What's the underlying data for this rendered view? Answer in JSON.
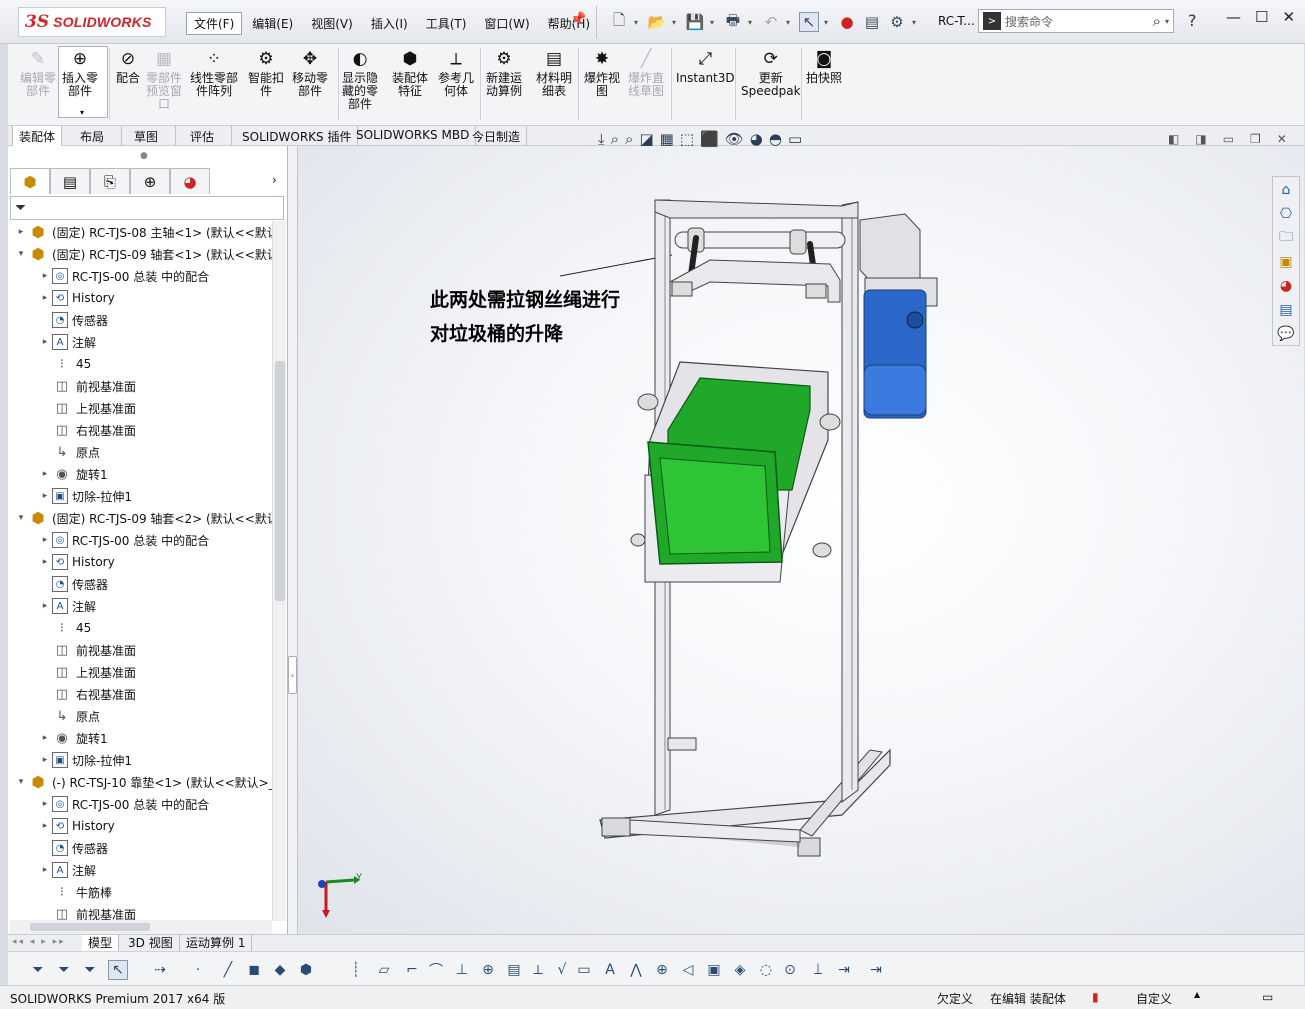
{
  "app": {
    "logo_prefix": "3S",
    "logo_text": "SOLIDWORKS",
    "doc_short": "RC-T...",
    "search_placeholder": "搜索命令",
    "help_label": "?"
  },
  "menus": [
    "文件(F)",
    "编辑(E)",
    "视图(V)",
    "插入(I)",
    "工具(T)",
    "窗口(W)",
    "帮助(H)"
  ],
  "commands": [
    {
      "label": "编辑零\n部件",
      "icon": "edit-component-icon",
      "glyph": "✎",
      "disabled": true
    },
    {
      "label": "插入零\n部件",
      "icon": "insert-component-icon",
      "glyph": "⊕",
      "disabled": false
    },
    {
      "label": "配合",
      "icon": "mate-icon",
      "glyph": "⊘",
      "disabled": false
    },
    {
      "label": "零部件\n预览窗\n口",
      "icon": "component-preview-icon",
      "glyph": "▦",
      "disabled": true
    },
    {
      "label": "线性零部\n件阵列",
      "icon": "linear-pattern-icon",
      "glyph": "⁘",
      "disabled": false
    },
    {
      "label": "智能扣\n件",
      "icon": "smart-fastener-icon",
      "glyph": "⚙",
      "disabled": false
    },
    {
      "label": "移动零\n部件",
      "icon": "move-component-icon",
      "glyph": "✥",
      "disabled": false
    },
    {
      "label": "显示隐\n藏的零\n部件",
      "icon": "show-hidden-icon",
      "glyph": "◐",
      "disabled": false
    },
    {
      "label": "装配体\n特征",
      "icon": "assembly-feature-icon",
      "glyph": "⬢",
      "disabled": false
    },
    {
      "label": "参考几\n何体",
      "icon": "reference-geometry-icon",
      "glyph": "⟂",
      "disabled": false
    },
    {
      "label": "新建运\n动算例",
      "icon": "motion-study-icon",
      "glyph": "⚙",
      "disabled": false
    },
    {
      "label": "材料明\n细表",
      "icon": "bom-icon",
      "glyph": "▤",
      "disabled": false
    },
    {
      "label": "爆炸视\n图",
      "icon": "exploded-view-icon",
      "glyph": "✸",
      "disabled": false
    },
    {
      "label": "爆炸直\n线草图",
      "icon": "explode-line-icon",
      "glyph": "╱",
      "disabled": true
    },
    {
      "label": "Instant3D",
      "icon": "instant3d-icon",
      "glyph": "⤢",
      "disabled": false
    },
    {
      "label": "更新\nSpeedpak",
      "icon": "speedpak-icon",
      "glyph": "⟳",
      "disabled": false
    },
    {
      "label": "拍快照",
      "icon": "snapshot-icon",
      "glyph": "◙",
      "disabled": false
    }
  ],
  "cmd_tabs": [
    "装配体",
    "布局",
    "草图",
    "评估",
    "SOLIDWORKS 插件",
    "SOLIDWORKS MBD",
    "今日制造"
  ],
  "tree": [
    {
      "indent": 0,
      "toggle": "▸",
      "icon": "part",
      "label": "(固定) RC-TJS-08 主轴<1> (默认<<默认"
    },
    {
      "indent": 0,
      "toggle": "▾",
      "icon": "part",
      "label": "(固定) RC-TJS-09 轴套<1> (默认<<默认"
    },
    {
      "indent": 1,
      "toggle": "▸",
      "icon": "mates",
      "label": "RC-TJS-00 总装 中的配合"
    },
    {
      "indent": 1,
      "toggle": "▸",
      "icon": "history",
      "label": "History"
    },
    {
      "indent": 1,
      "toggle": "",
      "icon": "sensor",
      "label": "传感器"
    },
    {
      "indent": 1,
      "toggle": "▸",
      "icon": "annotation",
      "label": "注解"
    },
    {
      "indent": 1,
      "toggle": "",
      "icon": "material",
      "label": "45"
    },
    {
      "indent": 1,
      "toggle": "",
      "icon": "plane",
      "label": "前视基准面"
    },
    {
      "indent": 1,
      "toggle": "",
      "icon": "plane",
      "label": "上视基准面"
    },
    {
      "indent": 1,
      "toggle": "",
      "icon": "plane",
      "label": "右视基准面"
    },
    {
      "indent": 1,
      "toggle": "",
      "icon": "origin",
      "label": "原点"
    },
    {
      "indent": 1,
      "toggle": "▸",
      "icon": "revolve",
      "label": "旋转1"
    },
    {
      "indent": 1,
      "toggle": "▸",
      "icon": "cut",
      "label": "切除-拉伸1"
    },
    {
      "indent": 0,
      "toggle": "▾",
      "icon": "part",
      "label": "(固定) RC-TJS-09 轴套<2> (默认<<默认"
    },
    {
      "indent": 1,
      "toggle": "▸",
      "icon": "mates",
      "label": "RC-TJS-00 总装 中的配合"
    },
    {
      "indent": 1,
      "toggle": "▸",
      "icon": "history",
      "label": "History"
    },
    {
      "indent": 1,
      "toggle": "",
      "icon": "sensor",
      "label": "传感器"
    },
    {
      "indent": 1,
      "toggle": "▸",
      "icon": "annotation",
      "label": "注解"
    },
    {
      "indent": 1,
      "toggle": "",
      "icon": "material",
      "label": "45"
    },
    {
      "indent": 1,
      "toggle": "",
      "icon": "plane",
      "label": "前视基准面"
    },
    {
      "indent": 1,
      "toggle": "",
      "icon": "plane",
      "label": "上视基准面"
    },
    {
      "indent": 1,
      "toggle": "",
      "icon": "plane",
      "label": "右视基准面"
    },
    {
      "indent": 1,
      "toggle": "",
      "icon": "origin",
      "label": "原点"
    },
    {
      "indent": 1,
      "toggle": "▸",
      "icon": "revolve",
      "label": "旋转1"
    },
    {
      "indent": 1,
      "toggle": "▸",
      "icon": "cut",
      "label": "切除-拉伸1"
    },
    {
      "indent": 0,
      "toggle": "▾",
      "icon": "part",
      "label": "(-) RC-TSJ-10 靠垫<1> (默认<<默认>_"
    },
    {
      "indent": 1,
      "toggle": "▸",
      "icon": "mates",
      "label": "RC-TJS-00 总装 中的配合"
    },
    {
      "indent": 1,
      "toggle": "▸",
      "icon": "history",
      "label": "History"
    },
    {
      "indent": 1,
      "toggle": "",
      "icon": "sensor",
      "label": "传感器"
    },
    {
      "indent": 1,
      "toggle": "▸",
      "icon": "annotation",
      "label": "注解"
    },
    {
      "indent": 1,
      "toggle": "",
      "icon": "material",
      "label": "牛筋棒"
    },
    {
      "indent": 1,
      "toggle": "",
      "icon": "plane",
      "label": "前视基准面"
    }
  ],
  "annotation": {
    "line1": "此两处需拉钢丝绳进行",
    "line2": "对垃圾桶的升降"
  },
  "bottom_tabs": [
    "模型",
    "3D 视图",
    "运动算例 1"
  ],
  "status": {
    "product": "SOLIDWORKS Premium 2017 x64 版",
    "definition": "欠定义",
    "editing": "在编辑 装配体",
    "units": "自定义"
  },
  "colors": {
    "brand_red": "#d4242b",
    "bin_green": "#1fa82a",
    "motor_blue": "#2a67c9"
  }
}
